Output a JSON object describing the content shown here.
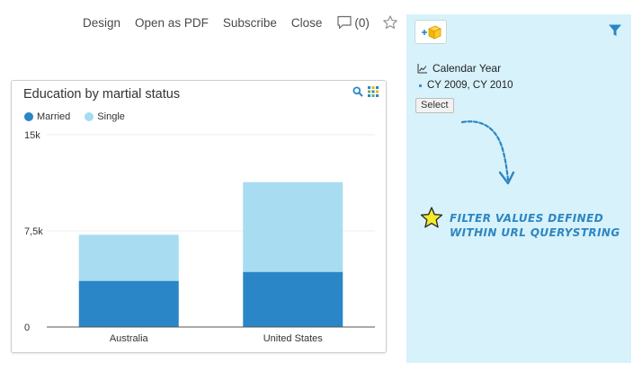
{
  "toolbar": {
    "design": "Design",
    "open_pdf": "Open as PDF",
    "subscribe": "Subscribe",
    "close": "Close",
    "comments_count": "(0)"
  },
  "card": {
    "title": "Education by martial status"
  },
  "colors": {
    "married": "#2a86c6",
    "single": "#a8dcf1",
    "panel_bg": "#d7f2fb",
    "accent": "#2e86c1"
  },
  "filter": {
    "field": "Calendar Year",
    "value": "CY 2009, CY 2010",
    "select_label": "Select",
    "note": "Filter values defined within URL querystring"
  },
  "chart_data": {
    "type": "bar",
    "stacked": true,
    "categories": [
      "Australia",
      "United States"
    ],
    "series": [
      {
        "name": "Married",
        "values": [
          3600,
          4300
        ]
      },
      {
        "name": "Single",
        "values": [
          3600,
          7000
        ]
      }
    ],
    "yticks": [
      "0",
      "7,5k",
      "15k"
    ],
    "ylim": [
      0,
      15000
    ],
    "grid": true,
    "legend": "top-left"
  }
}
